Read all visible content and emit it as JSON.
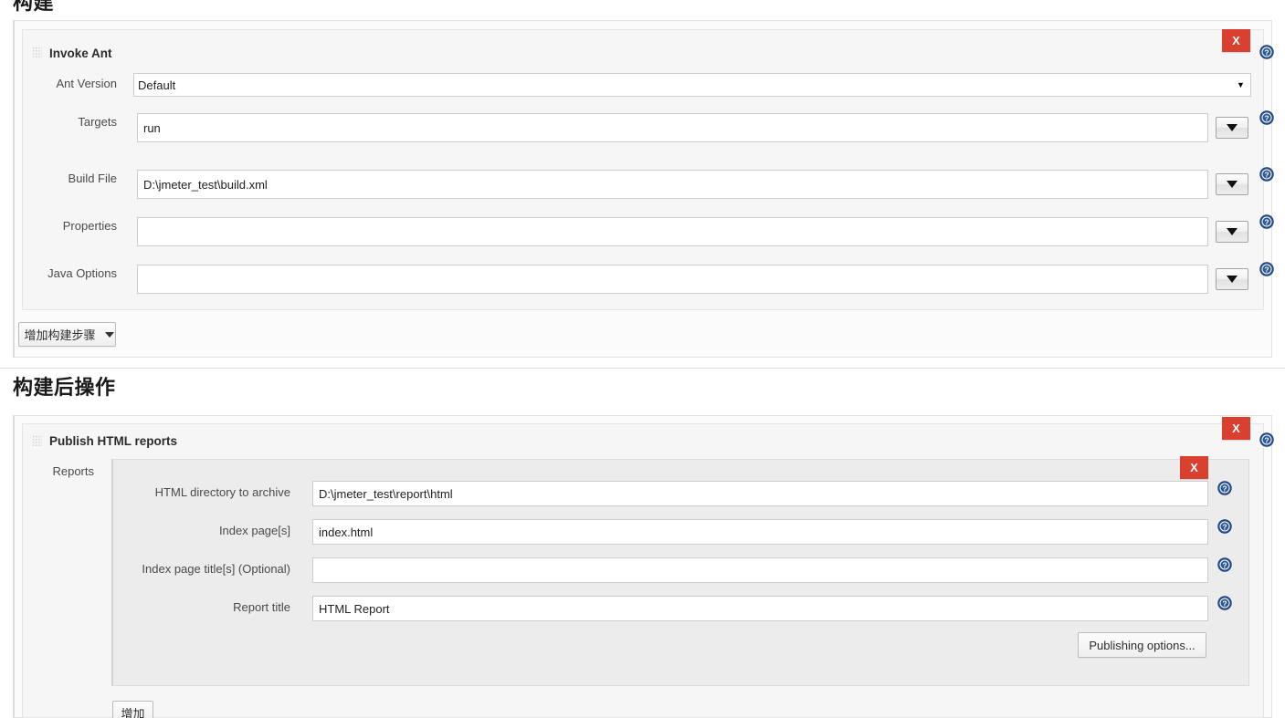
{
  "sections": {
    "build": {
      "heading": "构建",
      "add_step_button": "增加构建步骤"
    },
    "post_build": {
      "heading": "构建后操作",
      "add_button": "增加"
    }
  },
  "invoke_ant": {
    "title": "Invoke Ant",
    "delete_label": "X",
    "fields": {
      "ant_version": {
        "label": "Ant Version",
        "value": "Default",
        "options": [
          "Default"
        ]
      },
      "targets": {
        "label": "Targets",
        "value": "run",
        "placeholder": ""
      },
      "build_file": {
        "label": "Build File",
        "value": "D:\\jmeter_test\\build.xml",
        "placeholder": ""
      },
      "properties": {
        "label": "Properties",
        "value": "",
        "placeholder": ""
      },
      "java_options": {
        "label": "Java Options",
        "value": "",
        "placeholder": ""
      }
    }
  },
  "publish_html_reports": {
    "title": "Publish HTML reports",
    "delete_label": "X",
    "reports_label": "Reports",
    "report_delete_label": "X",
    "fields": {
      "html_directory": {
        "label": "HTML directory to archive",
        "value": "D:\\jmeter_test\\report\\html",
        "placeholder": ""
      },
      "index_pages": {
        "label": "Index page[s]",
        "value": "index.html",
        "placeholder": ""
      },
      "index_page_titles": {
        "label": "Index page title[s] (Optional)",
        "value": "",
        "placeholder": ""
      },
      "report_title": {
        "label": "Report title",
        "value": "HTML Report",
        "placeholder": ""
      }
    },
    "publishing_options_button": "Publishing options..."
  },
  "icons": {
    "help": "help-icon",
    "grip": "drag-grip-icon",
    "dropdown": "chevron-down-icon"
  },
  "colors": {
    "delete_red": "#d9402f",
    "help_blue": "#2b5797",
    "page_bg": "#ffffff",
    "panel_bg": "#f6f6f6"
  }
}
